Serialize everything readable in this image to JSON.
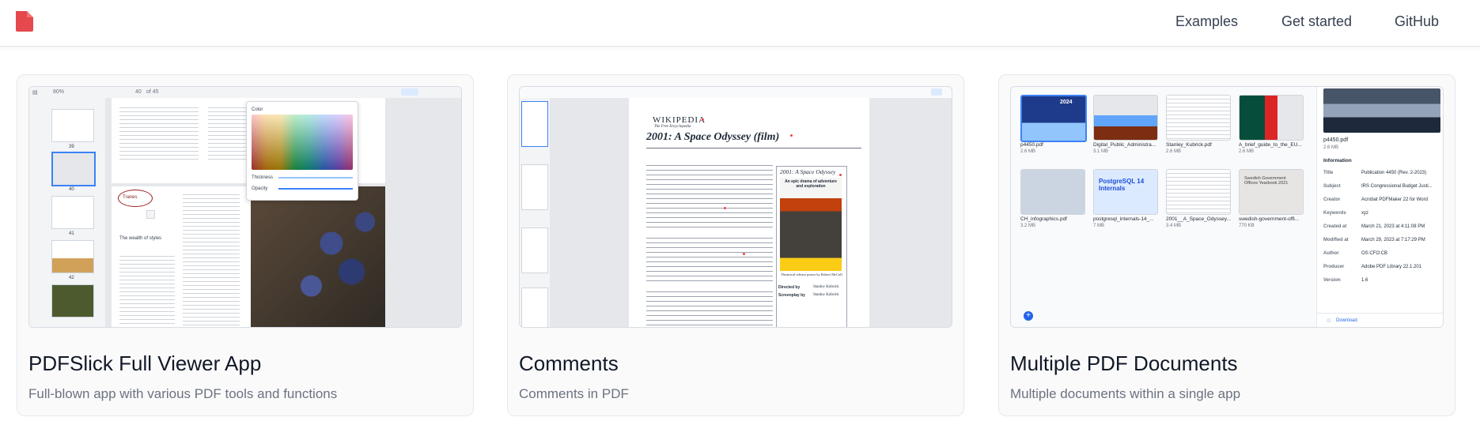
{
  "nav": {
    "items": [
      "Examples",
      "Get started",
      "GitHub"
    ]
  },
  "brand": {
    "accent": "#e5484d"
  },
  "cards": [
    {
      "title": "PDFSlick Full Viewer App",
      "description": "Full-blown app with various PDF tools and functions",
      "preview": {
        "zoom": "80%",
        "page": "40",
        "of_pages": "of 45",
        "thumb_pages": [
          "39",
          "40",
          "41",
          "42"
        ],
        "color_label": "Color",
        "thickness_label": "Thickness",
        "opacity_label": "Opacity",
        "annotation_text": "Tranes",
        "section_heading": "The wealth of styles"
      }
    },
    {
      "title": "Comments",
      "description": "Comments in PDF",
      "preview": {
        "wiki_logo": "WIKIPEDIA",
        "wiki_tagline": "The Free Encyclopedia",
        "article_title": "2001: A Space Odyssey (film)",
        "infobox_title": "2001: A Space Odyssey",
        "poster_tagline": "An epic drama of adventure and exploration",
        "poster_caption": "Theatrical release poster by Robert McCall",
        "directed_by_label": "Directed by",
        "directed_by_value": "Stanley Kubrick",
        "screenplay_label": "Screenplay by",
        "screenplay_value": "Stanley Kubrick"
      }
    },
    {
      "title": "Multiple PDF Documents",
      "description": "Multiple documents within a single app",
      "preview": {
        "files": [
          {
            "name": "p4450.pdf",
            "size": "2.6 MB"
          },
          {
            "name": "Digital_Public_Administra...",
            "size": "3.1 MB"
          },
          {
            "name": "Stanley_Kubrick.pdf",
            "size": "2.6 MB"
          },
          {
            "name": "A_brief_guide_to_the_EU...",
            "size": "2.6 MB"
          },
          {
            "name": "CH_infographics.pdf",
            "size": "3.2 MB"
          },
          {
            "name": "postgresql_internals-14_...",
            "size": "7 MB"
          },
          {
            "name": "2001__A_Space_Odyssey...",
            "size": "3.4 MB"
          },
          {
            "name": "swedish-government-offi...",
            "size": "770 KB"
          }
        ],
        "selected_file": "p4450.pdf",
        "selected_size": "2.6 MB",
        "info_heading": "Information",
        "info": [
          {
            "label": "Title",
            "value": "Publication 4450 (Rev. 2-2023)"
          },
          {
            "label": "Subject",
            "value": "IRS Congressional Budget Justi..."
          },
          {
            "label": "Creator",
            "value": "Acrobat PDFMaker 22 for Word"
          },
          {
            "label": "Keywords",
            "value": "xyz"
          },
          {
            "label": "Created at",
            "value": "March 21, 2023 at 4:11:08 PM"
          },
          {
            "label": "Modified at",
            "value": "March 29, 2023 at 7:17:29 PM"
          },
          {
            "label": "Author",
            "value": "OS:CFO:CB"
          },
          {
            "label": "Producer",
            "value": "Adobe PDF Library 22.1.201"
          },
          {
            "label": "Version",
            "value": "1.6"
          }
        ],
        "download_label": "Download",
        "postgres_tile_text": "PostgreSQL 14 Internals",
        "swedish_tile_text": "Swedish Government Offices Yearbook 2021",
        "budget_tile_year": "2024"
      }
    }
  ]
}
